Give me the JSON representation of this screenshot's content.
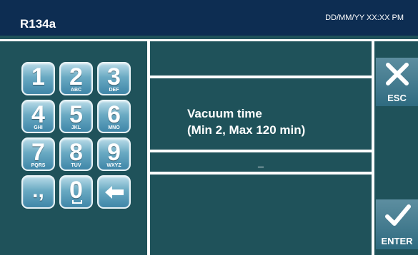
{
  "header": {
    "title": "R134a",
    "datetime": "DD/MM/YY XX:XX PM"
  },
  "prompt": {
    "line1": "Vacuum time",
    "line2": "(Min 2, Max 120 min)"
  },
  "input": {
    "value": "_"
  },
  "keypad": {
    "keys": [
      {
        "digit": "1",
        "letters": ""
      },
      {
        "digit": "2",
        "letters": "ABC"
      },
      {
        "digit": "3",
        "letters": "DEF"
      },
      {
        "digit": "4",
        "letters": "GHI"
      },
      {
        "digit": "5",
        "letters": "JKL"
      },
      {
        "digit": "6",
        "letters": "MNO"
      },
      {
        "digit": "7",
        "letters": "PQRS"
      },
      {
        "digit": "8",
        "letters": "TUV"
      },
      {
        "digit": "9",
        "letters": "WXYZ"
      }
    ],
    "punct_label": ".,",
    "zero_digit": "0",
    "backspace_icon": "arrow-left-icon"
  },
  "buttons": {
    "esc_label": "ESC",
    "esc_icon": "close-x-icon",
    "enter_label": "ENTER",
    "enter_icon": "checkmark-icon"
  },
  "colors": {
    "header_bg": "#0d2d52",
    "screen_bg": "#1f525a",
    "key_top": "#b9dbe8",
    "key_bottom": "#3f86a8",
    "side_button": "#2f6b80"
  }
}
